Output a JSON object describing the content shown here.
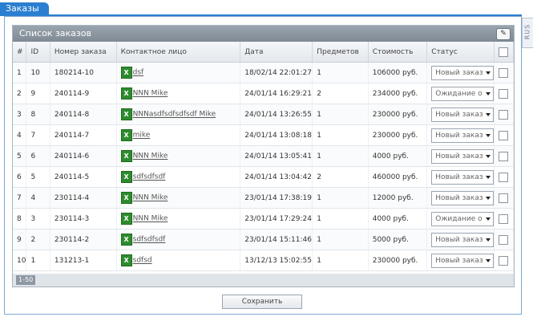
{
  "tab": {
    "label": "Заказы"
  },
  "lang_tab": {
    "label": "RUS"
  },
  "panel": {
    "title": "Список заказов"
  },
  "table": {
    "columns": [
      "#",
      "ID",
      "Номер заказа",
      "Контактное лицо",
      "Дата",
      "Предметов",
      "Стоимость",
      "Статус"
    ],
    "rows": [
      {
        "n": "1",
        "id": "10",
        "order": "180214-10",
        "contact": "dsf",
        "date": "18/02/14 22:01:27",
        "items": "1",
        "cost": "106000 руб.",
        "status": "Новый заказ"
      },
      {
        "n": "2",
        "id": "9",
        "order": "240114-9",
        "contact": "NNN Mike",
        "date": "24/01/14 16:29:21",
        "items": "2",
        "cost": "234000 руб.",
        "status": "Ожидание о"
      },
      {
        "n": "3",
        "id": "8",
        "order": "240114-8",
        "contact": "NNNasdfsdfsdfsdf Mike",
        "date": "24/01/14 13:26:55",
        "items": "1",
        "cost": "230000 руб.",
        "status": "Новый заказ"
      },
      {
        "n": "4",
        "id": "7",
        "order": "240114-7",
        "contact": "mike",
        "date": "24/01/14 13:08:18",
        "items": "1",
        "cost": "230000 руб.",
        "status": "Новый заказ"
      },
      {
        "n": "5",
        "id": "6",
        "order": "240114-6",
        "contact": "NNN Mike",
        "date": "24/01/14 13:05:41",
        "items": "1",
        "cost": "4000 руб.",
        "status": "Новый заказ"
      },
      {
        "n": "6",
        "id": "5",
        "order": "240114-5",
        "contact": "sdfsdfsdf",
        "date": "24/01/14 13:04:42",
        "items": "2",
        "cost": "460000 руб.",
        "status": "Новый заказ"
      },
      {
        "n": "7",
        "id": "4",
        "order": "230114-4",
        "contact": "NNN Mike",
        "date": "23/01/14 17:38:19",
        "items": "1",
        "cost": "12000 руб.",
        "status": "Новый заказ"
      },
      {
        "n": "8",
        "id": "3",
        "order": "230114-3",
        "contact": "NNN Mike",
        "date": "23/01/14 17:29:24",
        "items": "1",
        "cost": "4000 руб.",
        "status": "Ожидание о"
      },
      {
        "n": "9",
        "id": "2",
        "order": "230114-2",
        "contact": "sdfsdfsdf",
        "date": "23/01/14 15:11:46",
        "items": "1",
        "cost": "5000 руб.",
        "status": "Новый заказ"
      },
      {
        "n": "10",
        "id": "1",
        "order": "131213-1",
        "contact": "sdfsd",
        "date": "13/12/13 15:02:55",
        "items": "1",
        "cost": "230000 руб.",
        "status": "Новый заказ"
      }
    ]
  },
  "pager": {
    "label": "1-50"
  },
  "save_button": {
    "label": "Сохранить"
  },
  "icons": {
    "excel": "excel-icon",
    "export": "export-icon"
  }
}
